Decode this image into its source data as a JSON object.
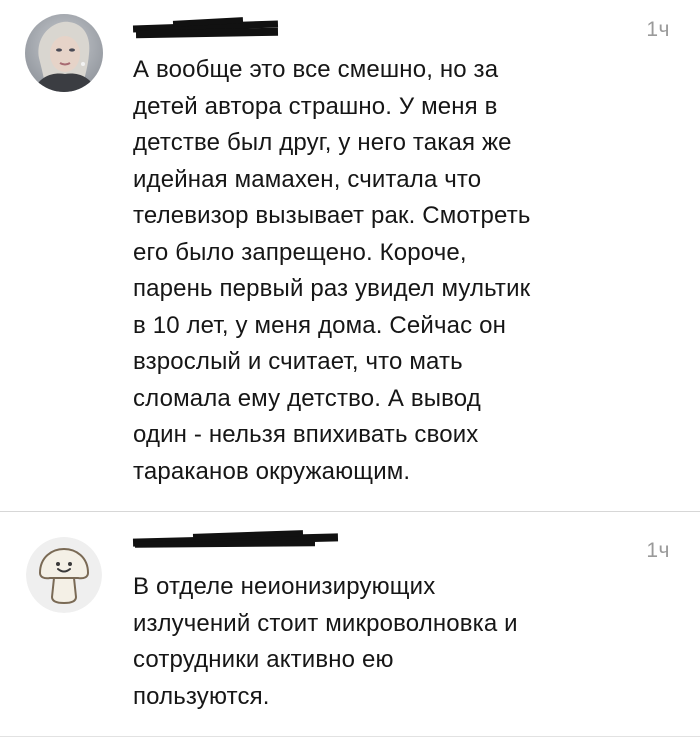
{
  "comments": [
    {
      "author": "",
      "time": "1ч",
      "lines": [
        "А вообще это все смешно, но за",
        "детей автора страшно. У меня в",
        "детстве был  друг, у него такая же",
        "идейная мамахен, считала  что",
        "телевизор вызывает рак. Смотреть",
        "его было запрещено. Короче,",
        "парень первый раз увидел мультик",
        "в 10 лет, у меня дома. Сейчас он",
        "взрослый и считает, что мать",
        "сломала ему детство. А вывод",
        "один - нельзя впихивать своих",
        "тараканов окружающим."
      ],
      "avatar_icon": "user-photo-avatar"
    },
    {
      "author": "",
      "time": "1ч",
      "lines": [
        "В отделе неионизирующих",
        "излучений стоит микроволновка и",
        "сотрудники активно ею",
        "пользуются."
      ],
      "avatar_icon": "mushroom-avatar"
    }
  ],
  "colors": {
    "background": "#ffffff",
    "text": "#161616",
    "time": "#9a9a9a",
    "divider": "#d7d7d7"
  }
}
